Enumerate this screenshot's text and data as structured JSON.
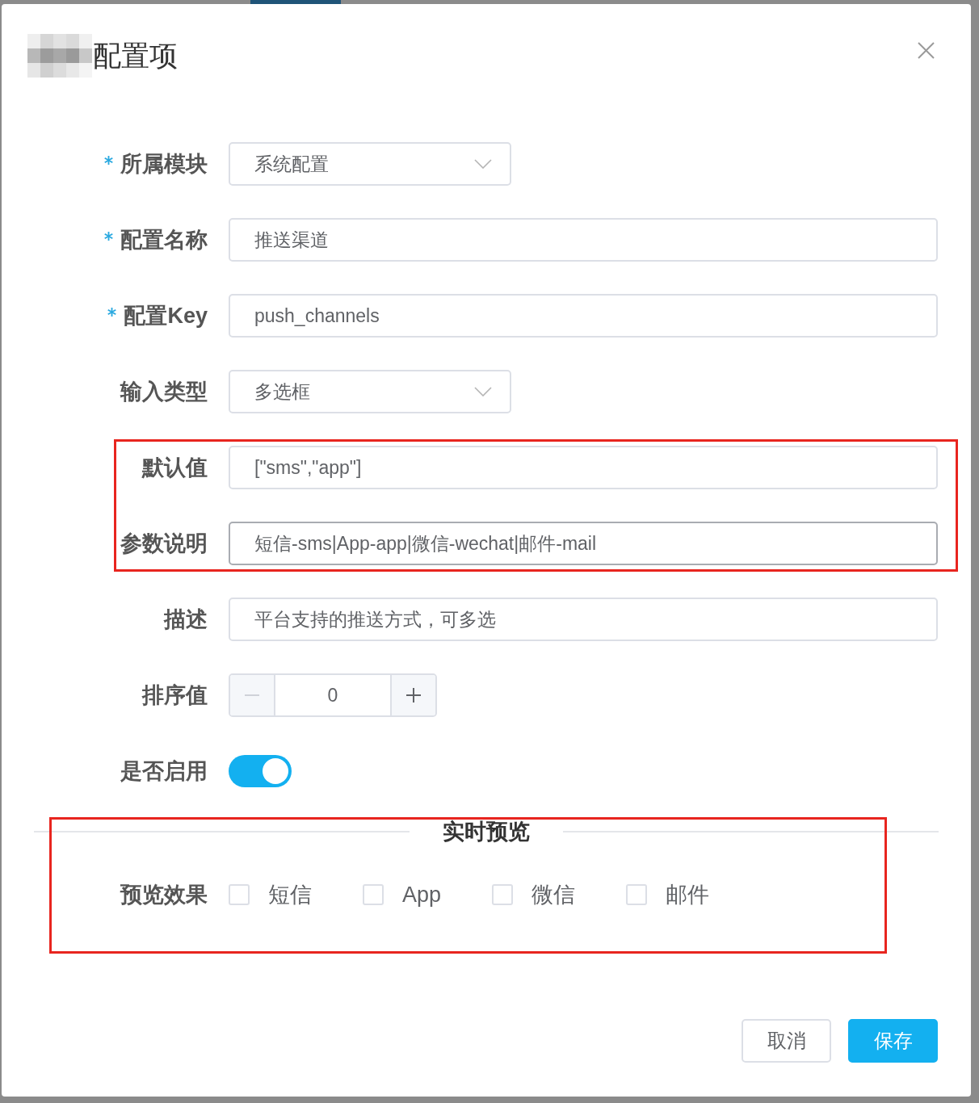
{
  "dialog": {
    "title": "配置项"
  },
  "form": {
    "sections": [
      {
        "highlighted": false,
        "fields": [
          {
            "kind": "select",
            "label": "所属模块",
            "required": true,
            "value": "系统配置",
            "hovered": false
          },
          {
            "kind": "input",
            "label": "配置名称",
            "required": true,
            "value": "推送渠道",
            "hovered": false
          },
          {
            "kind": "input",
            "label": "配置Key",
            "required": true,
            "value": "push_channels",
            "hovered": false
          },
          {
            "kind": "select",
            "label": "输入类型",
            "required": false,
            "value": "多选框",
            "hovered": false
          }
        ]
      },
      {
        "highlighted": true,
        "fields": [
          {
            "kind": "input",
            "label": "默认值",
            "required": false,
            "value": "[\"sms\",\"app\"]",
            "hovered": false
          },
          {
            "kind": "input",
            "label": "参数说明",
            "required": false,
            "value": "短信-sms|App-app|微信-wechat|邮件-mail",
            "hovered": true
          }
        ]
      },
      {
        "highlighted": false,
        "fields": [
          {
            "kind": "input",
            "label": "描述",
            "required": false,
            "value": "平台支持的推送方式，可多选",
            "hovered": false
          },
          {
            "kind": "number",
            "label": "排序值",
            "required": false,
            "value": "0",
            "minus_disabled": true
          },
          {
            "kind": "switch",
            "label": "是否启用",
            "required": false,
            "on": true
          }
        ]
      }
    ]
  },
  "preview": {
    "highlighted": true,
    "divider_title": "实时预览",
    "label": "预览效果",
    "options": [
      {
        "label": "短信",
        "checked": false
      },
      {
        "label": "App",
        "checked": false
      },
      {
        "label": "微信",
        "checked": false
      },
      {
        "label": "邮件",
        "checked": false
      }
    ]
  },
  "footer": {
    "buttons": [
      {
        "label": "取消",
        "kind": "default"
      },
      {
        "label": "保存",
        "kind": "primary"
      }
    ]
  }
}
